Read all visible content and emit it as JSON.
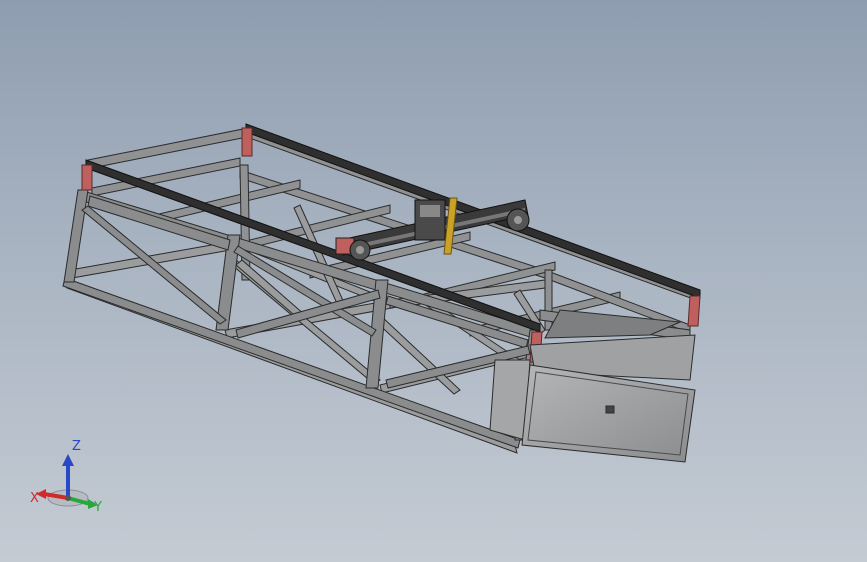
{
  "view": {
    "background_top": "#8e9db0",
    "background_bottom": "#c4cbd3",
    "model_colors": {
      "frame_face": "#8f9192",
      "frame_edge": "#2b2b2b",
      "rail": "#2f2f2f",
      "end_cap": "#c0605e",
      "torch": "#c9a227",
      "panel": "#a4a6a8"
    }
  },
  "triad": {
    "icon": "view-orientation-triad-icon",
    "x_label": "X",
    "y_label": "Y",
    "z_label": "Z",
    "x_color": "#d22a2a",
    "y_color": "#28a83a",
    "z_color": "#2848c8"
  }
}
